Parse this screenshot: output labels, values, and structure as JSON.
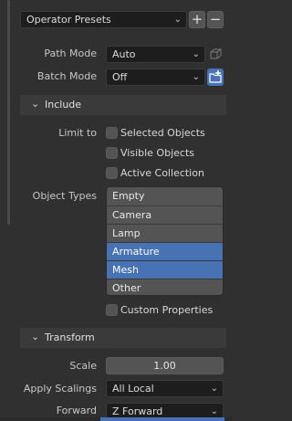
{
  "operator_presets": {
    "label": "Operator Presets",
    "add": "+",
    "remove": "−"
  },
  "path_mode": {
    "label": "Path Mode",
    "value": "Auto"
  },
  "batch_mode": {
    "label": "Batch Mode",
    "value": "Off"
  },
  "include": {
    "title": "Include",
    "limit_to_label": "Limit to",
    "checkboxes": [
      "Selected Objects",
      "Visible Objects",
      "Active Collection"
    ],
    "object_types_label": "Object Types",
    "object_types": [
      {
        "label": "Empty",
        "selected": false
      },
      {
        "label": "Camera",
        "selected": false
      },
      {
        "label": "Lamp",
        "selected": false
      },
      {
        "label": "Armature",
        "selected": true
      },
      {
        "label": "Mesh",
        "selected": true
      },
      {
        "label": "Other",
        "selected": false
      }
    ],
    "custom_properties": "Custom Properties"
  },
  "transform": {
    "title": "Transform",
    "scale_label": "Scale",
    "scale_value": "1.00",
    "apply_scalings_label": "Apply Scalings",
    "apply_scalings_value": "All Local",
    "forward_label": "Forward",
    "forward_value": "Z Forward"
  },
  "colors": {
    "accent": "#4772b3",
    "background": "#303030",
    "field": "#1d1d1d"
  }
}
